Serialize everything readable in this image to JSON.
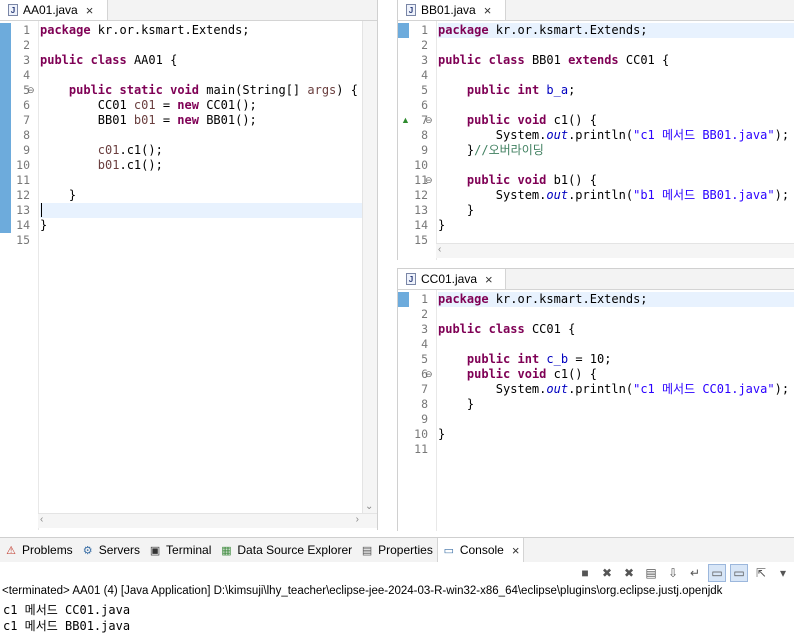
{
  "editors": {
    "aa01": {
      "tab": "AA01.java",
      "lines": [
        "<span class=\"kw\">package</span> kr.or.ksmart.Extends;",
        "",
        "<span class=\"kw\">public</span> <span class=\"kw\">class</span> AA01 {",
        "",
        "    <span class=\"kw\">public</span> <span class=\"kw\">static</span> <span class=\"kw\">void</span> main(String[] <span class=\"lvar\">args</span>) {",
        "        CC01 <span class=\"lvar\">c01</span> = <span class=\"kw\">new</span> CC01();",
        "        BB01 <span class=\"lvar\">b01</span> = <span class=\"kw\">new</span> BB01();",
        "",
        "        <span class=\"lvar\">c01</span>.c1();",
        "        <span class=\"lvar\">b01</span>.c1();",
        "",
        "    }",
        "",
        "}",
        ""
      ]
    },
    "bb01": {
      "tab": "BB01.java",
      "lines": [
        "<span class=\"kw\">package</span> kr.or.ksmart.Extends;",
        "",
        "<span class=\"kw\">public</span> <span class=\"kw\">class</span> BB01 <span class=\"kw\">extends</span> CC01 {",
        "",
        "    <span class=\"kw\">public</span> <span class=\"kw\">int</span> <span class=\"fld\">b_a</span>;",
        "",
        "    <span class=\"kw\">public</span> <span class=\"kw\">void</span> c1() {",
        "        System.<span class=\"sfld\">out</span>.println(<span class=\"str\">\"c1 메서드 BB01.java\"</span>);",
        "    }<span class=\"cmt\">//오버라이딩</span>",
        "",
        "    <span class=\"kw\">public</span> <span class=\"kw\">void</span> b1() {",
        "        System.<span class=\"sfld\">out</span>.println(<span class=\"str\">\"b1 메서드 BB01.java\"</span>);",
        "    }",
        "}",
        ""
      ]
    },
    "cc01": {
      "tab": "CC01.java",
      "lines": [
        "<span class=\"kw\">package</span> kr.or.ksmart.Extends;",
        "",
        "<span class=\"kw\">public</span> <span class=\"kw\">class</span> CC01 {",
        "",
        "    <span class=\"kw\">public</span> <span class=\"kw\">int</span> <span class=\"fld\">c_b</span> = 10;",
        "    <span class=\"kw\">public</span> <span class=\"kw\">void</span> c1() {",
        "        System.<span class=\"sfld\">out</span>.println(<span class=\"str\">\"c1 메서드 CC01.java\"</span>);",
        "    }",
        "",
        "}",
        ""
      ]
    }
  },
  "views": {
    "tabs": [
      {
        "label": "Problems",
        "icon": "problems-icon"
      },
      {
        "label": "Servers",
        "icon": "servers-icon"
      },
      {
        "label": "Terminal",
        "icon": "terminal-icon"
      },
      {
        "label": "Data Source Explorer",
        "icon": "data-source-icon"
      },
      {
        "label": "Properties",
        "icon": "properties-icon"
      },
      {
        "label": "Console",
        "icon": "console-icon"
      }
    ],
    "console_close": "×"
  },
  "console": {
    "status": "<terminated> AA01 (4) [Java Application] D:\\kimsuji\\lhy_teacher\\eclipse-jee-2024-03-R-win32-x86_64\\eclipse\\plugins\\org.eclipse.justj.openjdk",
    "output": [
      "c1 메서드 CC01.java",
      "c1 메서드 BB01.java"
    ]
  }
}
